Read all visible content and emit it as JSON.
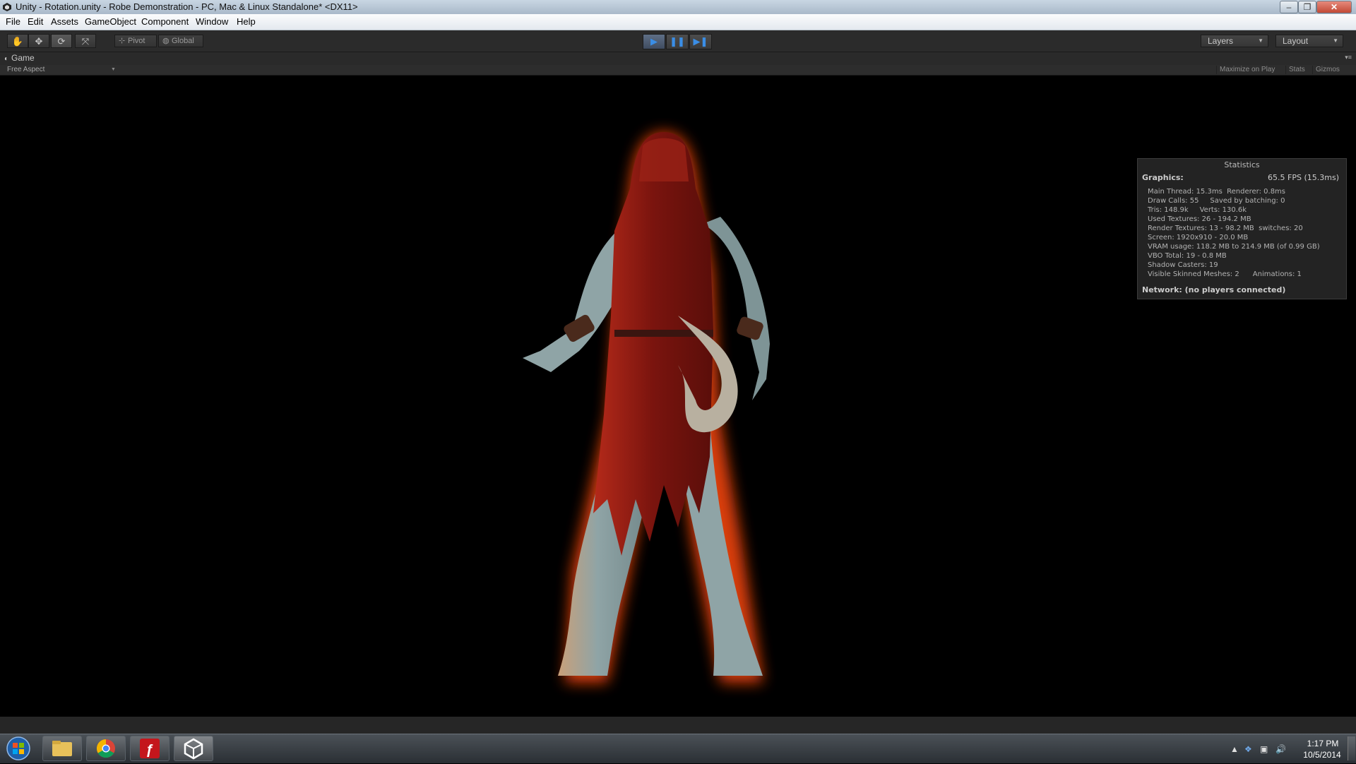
{
  "window": {
    "title": "Unity - Rotation.unity - Robe Demonstration - PC, Mac & Linux Standalone* <DX11>",
    "minimize": "–",
    "maximize": "❐",
    "close": "✕"
  },
  "menu": [
    "File",
    "Edit",
    "Assets",
    "GameObject",
    "Component",
    "Window",
    "Help"
  ],
  "toolbar": {
    "tools": [
      "hand-tool",
      "move-tool",
      "rotate-tool",
      "scale-tool"
    ],
    "pivot_label": "Pivot",
    "global_label": "Global",
    "playback": [
      "play",
      "pause",
      "step"
    ],
    "layers_label": "Layers",
    "layout_label": "Layout"
  },
  "game_view": {
    "tab_label": "Game",
    "aspect_label": "Free Aspect",
    "maximize_on_play": "Maximize on Play",
    "stats_label": "Stats",
    "gizmos_label": "Gizmos"
  },
  "statistics": {
    "title": "Statistics",
    "graphics_label": "Graphics:",
    "fps": "65.5 FPS (15.3ms)",
    "lines": [
      "Main Thread: 15.3ms  Renderer: 0.8ms",
      "Draw Calls: 55     Saved by batching: 0",
      "Tris: 148.9k     Verts: 130.6k",
      "Used Textures: 26 - 194.2 MB",
      "Render Textures: 13 - 98.2 MB  switches: 20",
      "Screen: 1920x910 - 20.0 MB",
      "VRAM usage: 118.2 MB to 214.9 MB (of 0.99 GB)",
      "VBO Total: 19 - 0.8 MB",
      "Shadow Casters: 19",
      "Visible Skinned Meshes: 2      Animations: 1"
    ],
    "network": "Network: (no players connected)"
  },
  "taskbar": {
    "apps": [
      "windows-explorer",
      "google-chrome",
      "adobe-flash",
      "unity"
    ],
    "time": "1:17 PM",
    "date": "10/5/2014"
  },
  "colors": {
    "robe": "#8e1a12",
    "skin": "#8fa4a6",
    "glow": "#ff5a1a",
    "play_accent": "#3a8ee6"
  }
}
